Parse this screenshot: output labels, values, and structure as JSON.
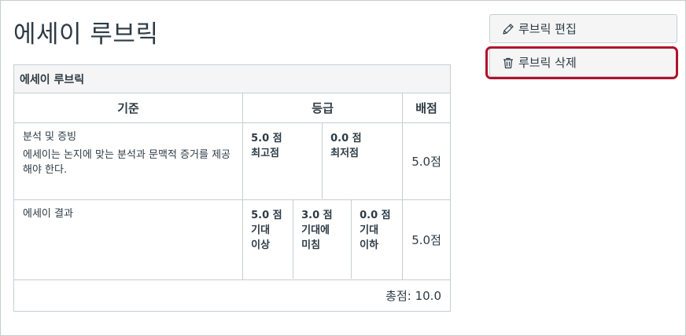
{
  "page": {
    "title": "에세이 루브릭"
  },
  "buttons": {
    "edit_label": "루브릭 편집",
    "delete_label": "루브릭 삭제"
  },
  "icons": {
    "edit": "pencil-icon",
    "delete": "trash-icon"
  },
  "rubric": {
    "caption": "에세이 루브릭",
    "headers": {
      "criteria": "기준",
      "ratings": "등급",
      "points": "배점"
    },
    "criteria": [
      {
        "title": "분석 및 증빙",
        "description": "에세이는 논지에 맞는 분석과 문맥적 증거를 제공해야 한다.",
        "ratings": [
          {
            "points": "5.0 점",
            "lines": [
              "최고점"
            ]
          },
          {
            "points": "0.0 점",
            "lines": [
              "최저점"
            ]
          }
        ],
        "points": "5.0점"
      },
      {
        "title": "에세이 결과",
        "description": "",
        "ratings": [
          {
            "points": "5.0 점",
            "lines": [
              "기대",
              "이상"
            ]
          },
          {
            "points": "3.0 점",
            "lines": [
              "기대에",
              "미침"
            ]
          },
          {
            "points": "0.0 점",
            "lines": [
              "기대",
              "이하"
            ]
          }
        ],
        "points": "5.0점"
      }
    ],
    "total": "총점: 10.0"
  },
  "colors": {
    "highlight": "#b0122c",
    "text": "#2d3b45",
    "border": "#c7cdd1",
    "header_bg": "#f5f5f5"
  }
}
